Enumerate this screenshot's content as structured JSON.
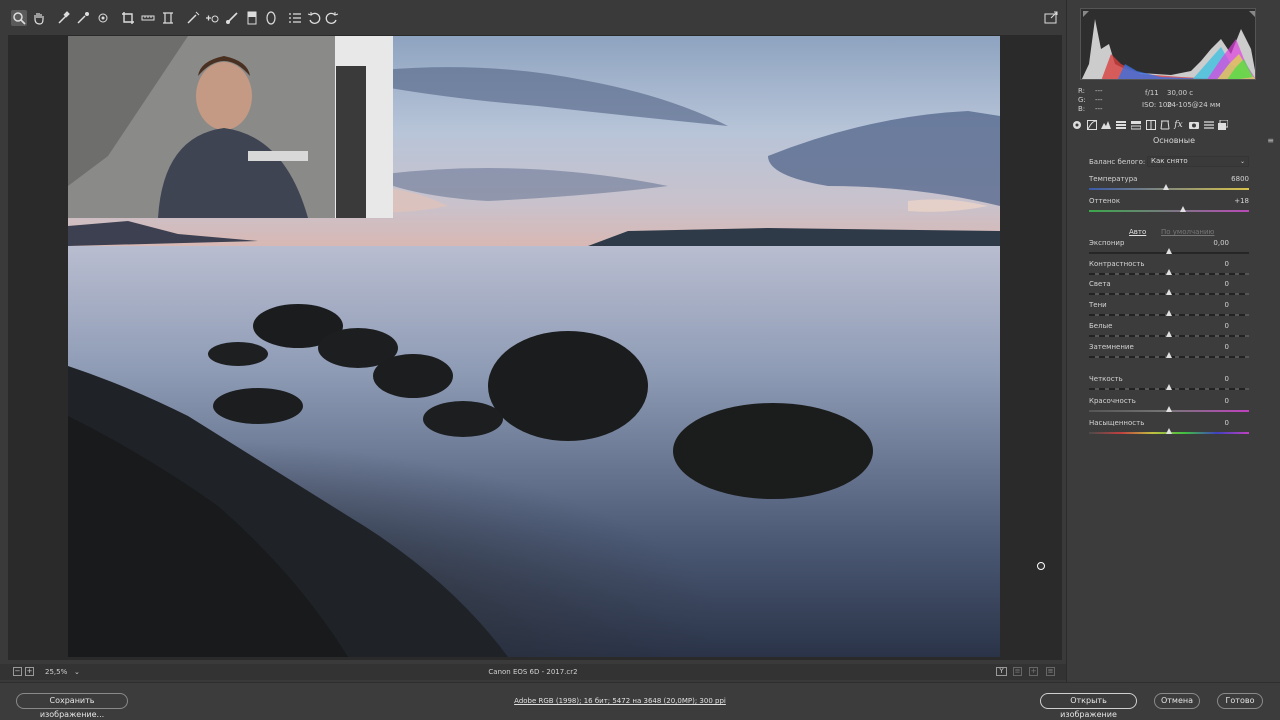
{
  "toolbar": {
    "tools": [
      "zoom-icon",
      "hand-icon",
      "white-balance-icon",
      "color-sampler-icon",
      "target-adjust-icon",
      "crop-icon",
      "straighten-icon",
      "transform-icon",
      "spot-removal-icon",
      "red-eye-icon",
      "adjustment-brush-icon",
      "graduated-filter-icon",
      "radial-filter-icon",
      "preferences-icon",
      "rotate-left-icon",
      "rotate-right-icon"
    ],
    "fullscreen_icon": "fullscreen-icon"
  },
  "meta": {
    "r_label": "R:",
    "g_label": "G:",
    "b_label": "B:",
    "r_val": "---",
    "g_val": "---",
    "b_val": "---",
    "aperture": "f/11",
    "shutter": "30,00 с",
    "iso": "ISO: 100",
    "lens": "24-105@24 мм"
  },
  "panel": {
    "section_title": "Основные",
    "wb_label": "Баланс белого:",
    "wb_value": "Как снято",
    "auto_link": "Авто",
    "default_link": "По умолчанию",
    "sliders": [
      {
        "label": "Температура",
        "value": "6800",
        "pos": 0.48
      },
      {
        "label": "Оттенок",
        "value": "+18",
        "pos": 0.59
      },
      {
        "label": "Экспонир",
        "value": "0,00",
        "pos": 0.5
      },
      {
        "label": "Контрастность",
        "value": "0",
        "pos": 0.5
      },
      {
        "label": "Света",
        "value": "0",
        "pos": 0.5
      },
      {
        "label": "Тени",
        "value": "0",
        "pos": 0.5
      },
      {
        "label": "Белые",
        "value": "0",
        "pos": 0.5
      },
      {
        "label": "Затемнение",
        "value": "0",
        "pos": 0.5
      },
      {
        "label": "Четкость",
        "value": "0",
        "pos": 0.5
      },
      {
        "label": "Красочность",
        "value": "0",
        "pos": 0.5
      },
      {
        "label": "Насыщенность",
        "value": "0",
        "pos": 0.5
      }
    ]
  },
  "statusbar": {
    "zoom": "25,5%",
    "filename": "Canon EOS 6D  -  2017.cr2"
  },
  "bottom": {
    "save_label": "Сохранить изображение...",
    "workflow": "Adobe RGB (1998); 16 бит; 5472 на 3648 (20,0MP); 300 ppi",
    "open_label": "Открыть изображение",
    "cancel_label": "Отмена",
    "done_label": "Готово"
  },
  "colors": {
    "temp_gradient": [
      "#3a5aa8",
      "#d8c24a"
    ],
    "tint_gradient": [
      "#3aa84a",
      "#b84ab8"
    ]
  }
}
